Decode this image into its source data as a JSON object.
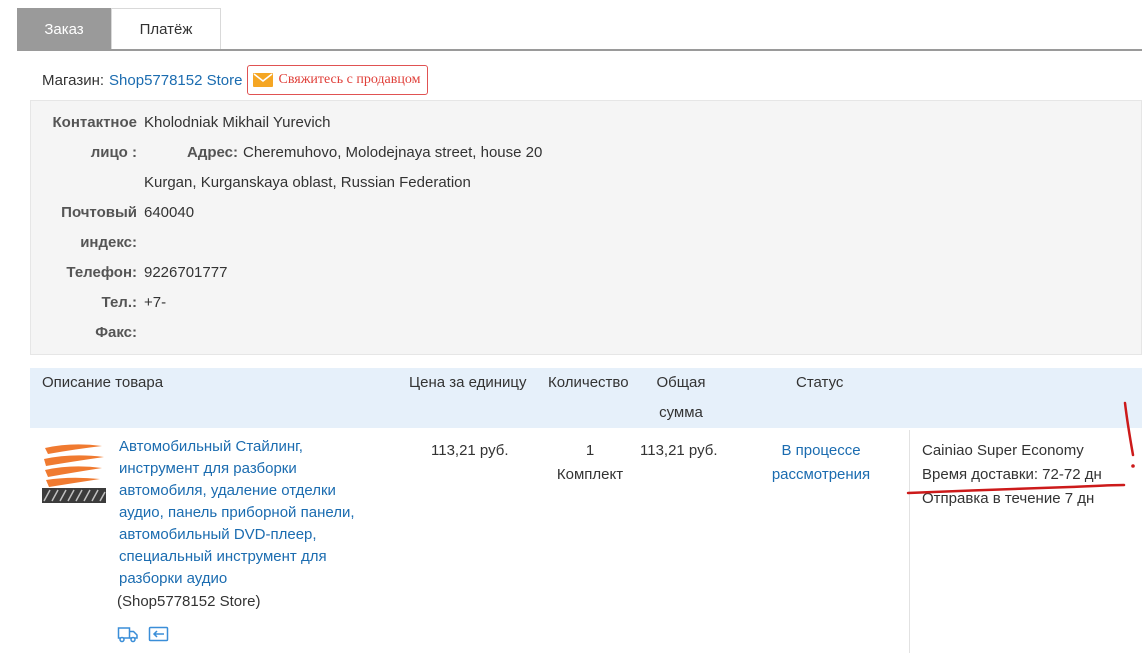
{
  "tabs": [
    {
      "label": "Заказ",
      "active": true
    },
    {
      "label": "Платёж",
      "active": false
    }
  ],
  "shop": {
    "label": "Магазин:",
    "name": "Shop5778152 Store",
    "contact_button": "Свяжитесь с продавцом"
  },
  "address": {
    "contact_label_1": "Контактное",
    "contact_label_2": "лицо :",
    "contact_value": "Kholodniak Mikhail Yurevich",
    "address_label": "Адрес:",
    "address_line1": "Cheremuhovo, Molodejnaya street, house 20",
    "address_line2": "Kurgan, Kurganskaya oblast, Russian Federation",
    "postal_label_1": "Почтовый",
    "postal_label_2": "индекс:",
    "postal_value": "640040",
    "phone_label": "Телефон:",
    "phone_value": "9226701777",
    "tel_label": "Тел.:",
    "tel_value": "+7-",
    "fax_label": "Факс:"
  },
  "table": {
    "headers": {
      "description": "Описание товара",
      "unit_price": "Цена за единицу",
      "quantity": "Количество",
      "total_1": "Общая",
      "total_2": "сумма",
      "status": "Статус"
    },
    "row": {
      "title_lines": [
        "Автомобильный Стайлинг,",
        "инструмент для разборки",
        "автомобиля, удаление отделки",
        "аудио, панель приборной панели,",
        "автомобильный DVD-плеер,",
        "специальный инструмент для",
        "разборки аудио"
      ],
      "store": "(Shop5778152 Store)",
      "unit_price": "113,21 руб.",
      "quantity": "1",
      "quantity_unit": "Комплект",
      "total": "113,21 руб.",
      "status_lines": [
        "В процессе",
        "рассмотрения"
      ],
      "shipping_method": "Cainiao Super Economy",
      "delivery_time": "Время доставки: 72-72 дн",
      "dispatch": "Отправка в течение 7 дн"
    }
  },
  "colors": {
    "link": "#1b6cb0",
    "tab_active": "#9a9a9a",
    "contact_red": "#e0403a",
    "header_bg": "#e6f0fa",
    "annotation": "#cc1a1a"
  },
  "icons": {
    "contact": "envelope-icon",
    "shipping": "truck-icon",
    "return": "return-icon"
  }
}
